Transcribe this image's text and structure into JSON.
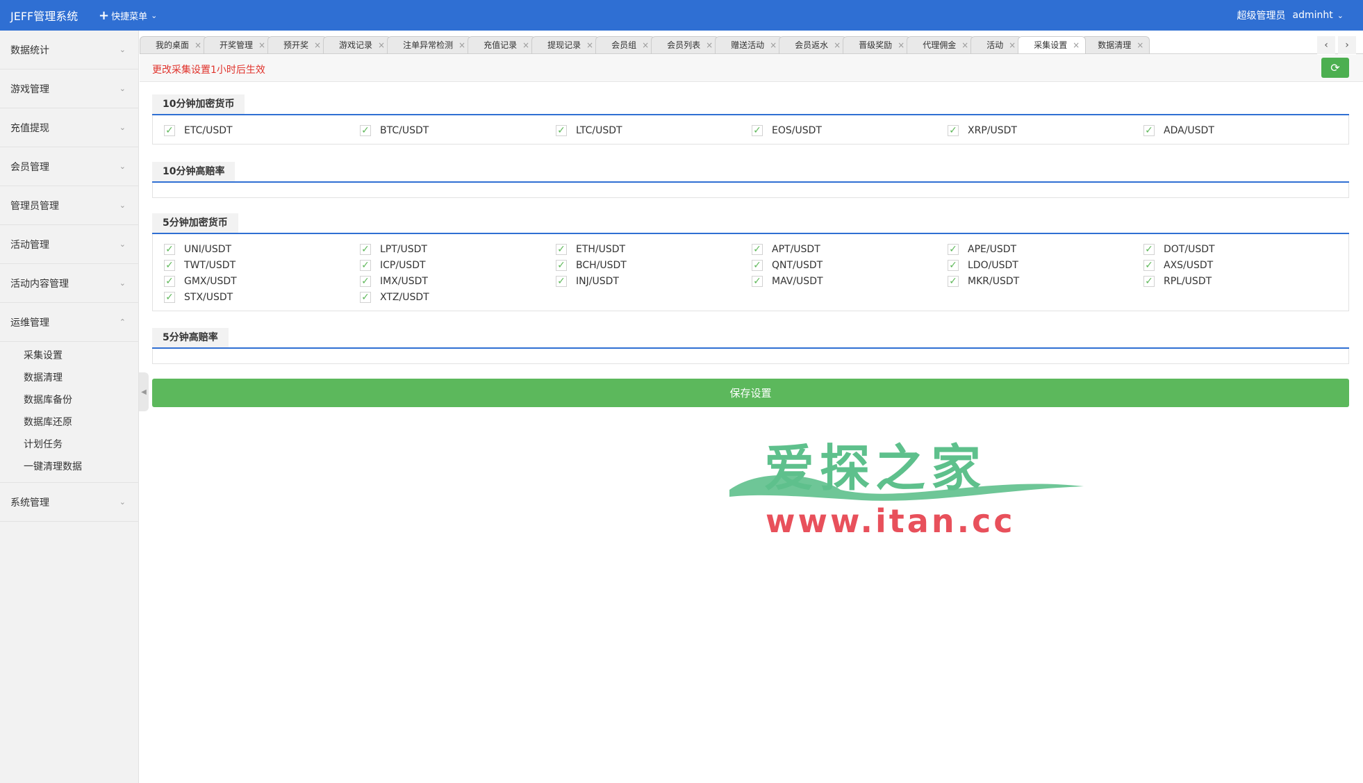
{
  "header": {
    "brand": "JEFF管理系统",
    "quick_menu": "快捷菜单",
    "role": "超级管理员",
    "username": "adminht"
  },
  "sidebar": {
    "items": [
      {
        "label": "数据统计"
      },
      {
        "label": "游戏管理"
      },
      {
        "label": "充值提现"
      },
      {
        "label": "会员管理"
      },
      {
        "label": "管理员管理"
      },
      {
        "label": "活动管理"
      },
      {
        "label": "活动内容管理"
      },
      {
        "label": "运维管理"
      },
      {
        "label": "系统管理"
      }
    ],
    "ops_submenu": [
      "采集设置",
      "数据清理",
      "数据库备份",
      "数据库还原",
      "计划任务",
      "一键清理数据"
    ]
  },
  "tabs": {
    "items": [
      "我的桌面",
      "开奖管理",
      "预开奖",
      "游戏记录",
      "注单异常检测",
      "充值记录",
      "提现记录",
      "会员组",
      "会员列表",
      "赠送活动",
      "会员返水",
      "晋级奖励",
      "代理佣金",
      "活动",
      "采集设置",
      "数据清理"
    ],
    "active": "采集设置"
  },
  "notice": "更改采集设置1小时后生效",
  "sections": {
    "s1": {
      "title": "10分钟加密货币",
      "items": [
        "ETC/USDT",
        "BTC/USDT",
        "LTC/USDT",
        "EOS/USDT",
        "XRP/USDT",
        "ADA/USDT"
      ]
    },
    "s2": {
      "title": "10分钟高赔率"
    },
    "s3": {
      "title": "5分钟加密货币",
      "items": [
        "UNI/USDT",
        "LPT/USDT",
        "ETH/USDT",
        "APT/USDT",
        "APE/USDT",
        "DOT/USDT",
        "TWT/USDT",
        "ICP/USDT",
        "BCH/USDT",
        "QNT/USDT",
        "LDO/USDT",
        "AXS/USDT",
        "GMX/USDT",
        "IMX/USDT",
        "INJ/USDT",
        "MAV/USDT",
        "MKR/USDT",
        "RPL/USDT",
        "STX/USDT",
        "XTZ/USDT"
      ]
    },
    "s4": {
      "title": "5分钟高赔率"
    }
  },
  "save_label": "保存设置",
  "watermark": {
    "cn": "爱探之家",
    "url": "www.itan.cc"
  },
  "colors": {
    "header": "#2f6fd3",
    "save": "#5cb85c",
    "notice": "#e0332c"
  }
}
